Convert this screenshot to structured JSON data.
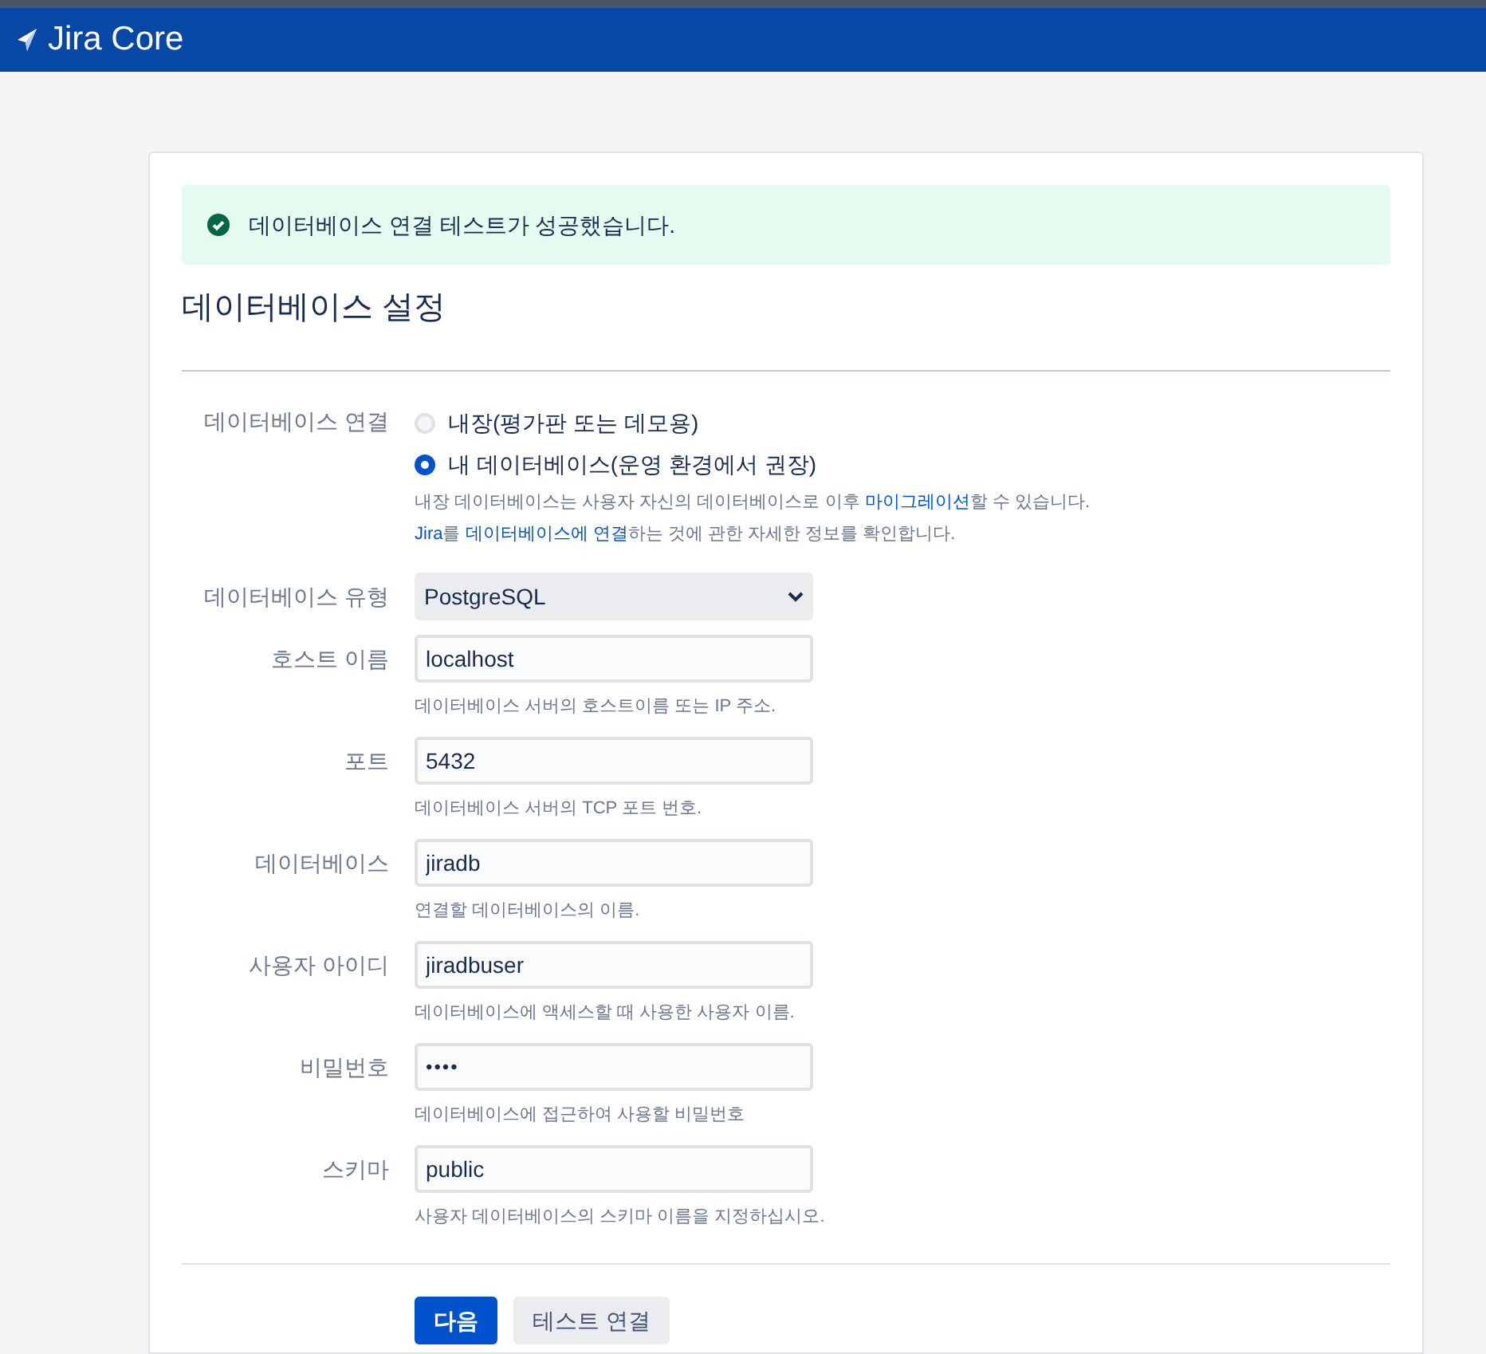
{
  "header": {
    "product": "Jira Core"
  },
  "alert": {
    "kind": "success",
    "message": "데이터베이스 연결 테스트가 성공했습니다."
  },
  "title": "데이터베이스 설정",
  "connection": {
    "label": "데이터베이스 연결",
    "options": [
      {
        "label": "내장(평가판 또는 데모용)",
        "selected": false
      },
      {
        "label": "내 데이터베이스(운영 환경에서 권장)",
        "selected": true
      }
    ],
    "help": [
      [
        {
          "kind": "text",
          "text": "내장 데이터베이스는 사용자 자신의 데이터베이스로 이후 "
        },
        {
          "kind": "link",
          "text": "마이그레이션"
        },
        {
          "kind": "text",
          "text": "할 수 있습니다."
        }
      ],
      [
        {
          "kind": "link",
          "text": "Jira"
        },
        {
          "kind": "text",
          "text": "를 "
        },
        {
          "kind": "link",
          "text": "데이터베이스에 연결"
        },
        {
          "kind": "text",
          "text": "하는 것에 관한 자세한 정보를 확인합니다."
        }
      ]
    ]
  },
  "fields": [
    {
      "kind": "select",
      "label": "데이터베이스 유형",
      "value": "PostgreSQL"
    },
    {
      "kind": "text",
      "label": "호스트 이름",
      "value": "localhost",
      "help": "데이터베이스 서버의 호스트이름 또는 IP 주소."
    },
    {
      "kind": "text",
      "label": "포트",
      "value": "5432",
      "help": "데이터베이스 서버의 TCP 포트 번호."
    },
    {
      "kind": "text",
      "label": "데이터베이스",
      "value": "jiradb",
      "help": "연결할 데이터베이스의 이름."
    },
    {
      "kind": "text",
      "label": "사용자 아이디",
      "value": "jiradbuser",
      "help": "데이터베이스에 액세스할 때 사용한 사용자 이름."
    },
    {
      "kind": "password",
      "label": "비밀번호",
      "value": "••••",
      "help": "데이터베이스에 접근하여 사용할 비밀번호"
    },
    {
      "kind": "text",
      "label": "스키마",
      "value": "public",
      "help": "사용자 데이터베이스의 스키마 이름을 지정하십시오."
    }
  ],
  "buttons": [
    {
      "label": "다음",
      "kind": "primary"
    },
    {
      "label": "테스트 연결",
      "kind": "secondary"
    }
  ]
}
